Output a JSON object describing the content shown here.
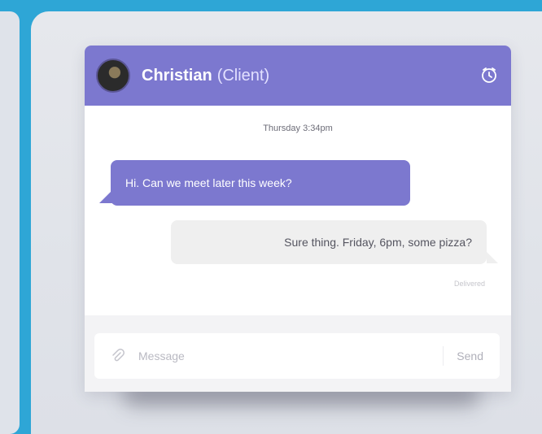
{
  "contact": {
    "name": "Christian",
    "role": "(Client)"
  },
  "chat": {
    "timestamp": "Thursday 3:34pm",
    "messages": [
      {
        "direction": "incoming",
        "text": "Hi. Can we meet later this week?"
      },
      {
        "direction": "outgoing",
        "text": "Sure thing. Friday, 6pm, some pizza?"
      }
    ],
    "read_receipt": "Delivered"
  },
  "composer": {
    "placeholder": "Message",
    "send_label": "Send"
  },
  "icons": {
    "header": "clock-icon",
    "attach": "paperclip-icon"
  },
  "colors": {
    "accent": "#7c78cf",
    "page_background": "#2ea6d6"
  }
}
